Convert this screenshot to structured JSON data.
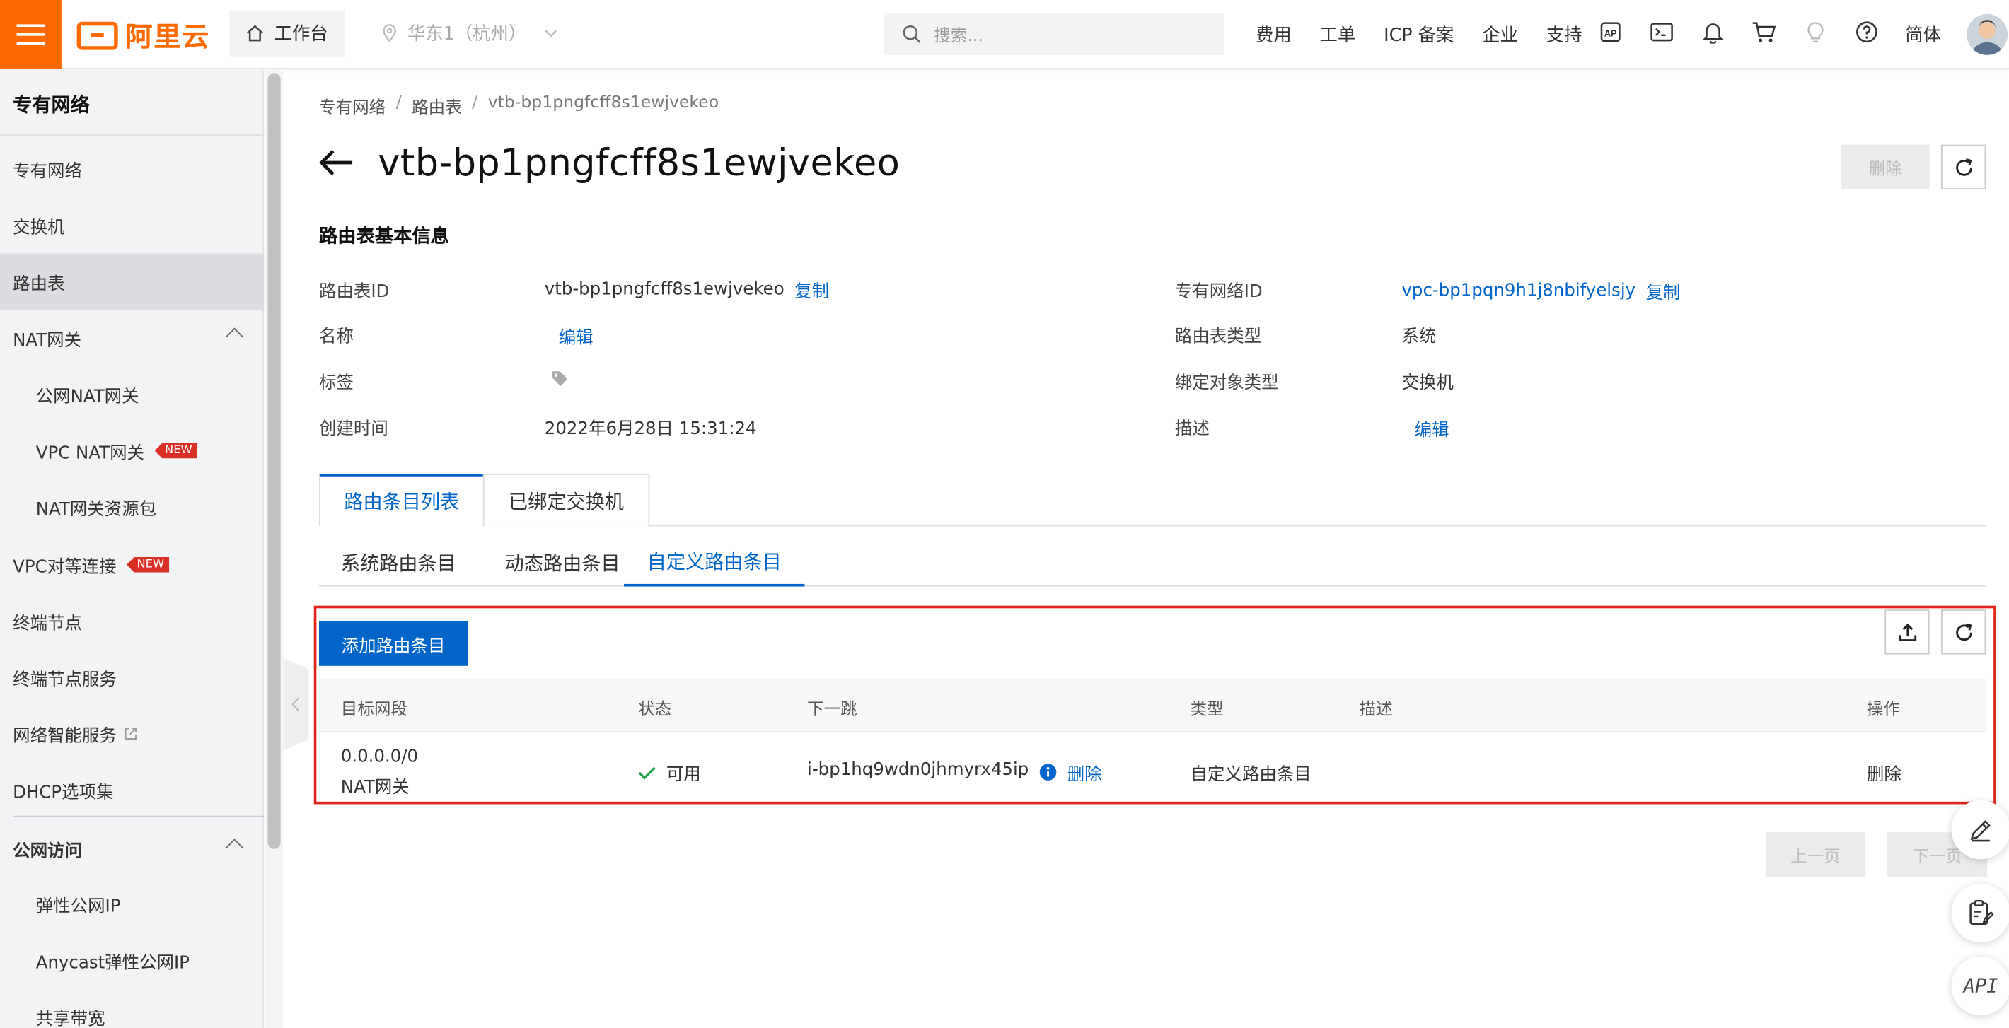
{
  "topbar": {
    "logo_text": "阿里云",
    "workbench": "工作台",
    "region": "华东1（杭州）",
    "search_placeholder": "搜索...",
    "nav": [
      "费用",
      "工单",
      "ICP 备案",
      "企业",
      "支持"
    ],
    "lang": "简体"
  },
  "sidebar": {
    "title": "专有网络",
    "items": [
      {
        "label": "专有网络"
      },
      {
        "label": "交换机"
      },
      {
        "label": "路由表"
      },
      {
        "label": "NAT网关"
      },
      {
        "label": "公网NAT网关"
      },
      {
        "label": "VPC NAT网关",
        "badge": "NEW"
      },
      {
        "label": "NAT网关资源包"
      },
      {
        "label": "VPC对等连接",
        "badge": "NEW"
      },
      {
        "label": "终端节点"
      },
      {
        "label": "终端节点服务"
      },
      {
        "label": "网络智能服务"
      },
      {
        "label": "DHCP选项集"
      },
      {
        "label": "公网访问"
      },
      {
        "label": "弹性公网IP"
      },
      {
        "label": "Anycast弹性公网IP"
      },
      {
        "label": "共享带宽"
      }
    ]
  },
  "breadcrumb": [
    "专有网络",
    "路由表",
    "vtb-bp1pngfcff8s1ewjvekeo"
  ],
  "page": {
    "title": "vtb-bp1pngfcff8s1ewjvekeo",
    "delete_label": "删除"
  },
  "basic_info": {
    "section_title": "路由表基本信息",
    "left": [
      {
        "label": "路由表ID",
        "value": "vtb-bp1pngfcff8s1ewjvekeo",
        "action": "复制"
      },
      {
        "label": "名称",
        "value": "",
        "action": "编辑"
      },
      {
        "label": "标签",
        "value": ""
      },
      {
        "label": "创建时间",
        "value": "2022年6月28日 15:31:24"
      }
    ],
    "right": [
      {
        "label": "专有网络ID",
        "value": "vpc-bp1pqn9h1j8nbifyelsjy",
        "action": "复制"
      },
      {
        "label": "路由表类型",
        "value": "系统"
      },
      {
        "label": "绑定对象类型",
        "value": "交换机"
      },
      {
        "label": "描述",
        "value": "",
        "action": "编辑"
      }
    ]
  },
  "tabs": {
    "primary": [
      "路由条目列表",
      "已绑定交换机"
    ],
    "secondary": [
      "系统路由条目",
      "动态路由条目",
      "自定义路由条目"
    ]
  },
  "table": {
    "add_button": "添加路由条目",
    "columns": [
      "目标网段",
      "状态",
      "下一跳",
      "类型",
      "描述",
      "操作"
    ],
    "rows": [
      {
        "target": "0.0.0.0/0",
        "target_sub": "NAT网关",
        "status": "可用",
        "next_hop": "i-bp1hq9wdn0jhmyrx45ip",
        "next_hop_action": "删除",
        "type": "自定义路由条目",
        "description": "",
        "operation": "删除"
      }
    ]
  },
  "pager": {
    "prev": "上一页",
    "next": "下一页"
  },
  "float": {
    "api": "API"
  },
  "colors": {
    "brand": "#ff6a00",
    "link": "#0064c8",
    "highlight": "#e1251b",
    "success": "#1fa24a"
  }
}
